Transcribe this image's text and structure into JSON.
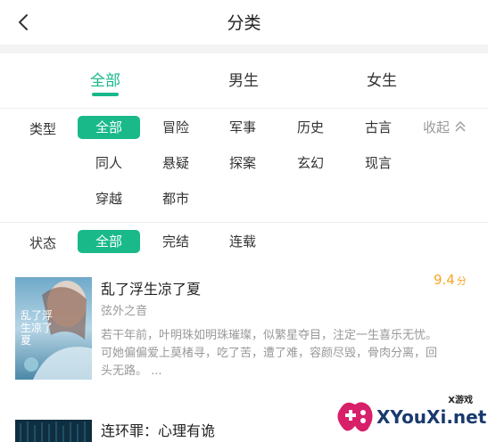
{
  "header": {
    "title": "分类"
  },
  "tabs": [
    {
      "label": "全部",
      "active": true
    },
    {
      "label": "男生",
      "active": false
    },
    {
      "label": "女生",
      "active": false
    }
  ],
  "type_filter": {
    "label": "类型",
    "collapse_label": "收起",
    "options": [
      "全部",
      "冒险",
      "军事",
      "历史",
      "古言",
      "同人",
      "悬疑",
      "探案",
      "玄幻",
      "现言",
      "穿越",
      "都市"
    ],
    "selected": "全部"
  },
  "status_filter": {
    "label": "状态",
    "options": [
      "全部",
      "完结",
      "连载"
    ],
    "selected": "全部"
  },
  "books": [
    {
      "title": "乱了浮生凉了夏",
      "author": "弦外之音",
      "score": "9.4",
      "score_unit": "分",
      "description_line1": "若干年前，叶明珠如明珠璀璨，似繁星夺目，注定一生喜乐无忧。",
      "description_line2": "可她偏偏爱上莫楮寻，吃了苦，遭了难，容颜尽毁，骨肉分离，回",
      "description_line3": "头无路。 ...",
      "cover_text": "乱了浮生凉了夏"
    },
    {
      "title": "连环罪：心理有诡"
    }
  ],
  "watermark": {
    "tag": "X游戏",
    "text": "XYouXi.net"
  },
  "colors": {
    "accent": "#19b98a",
    "score": "#f5a623"
  }
}
